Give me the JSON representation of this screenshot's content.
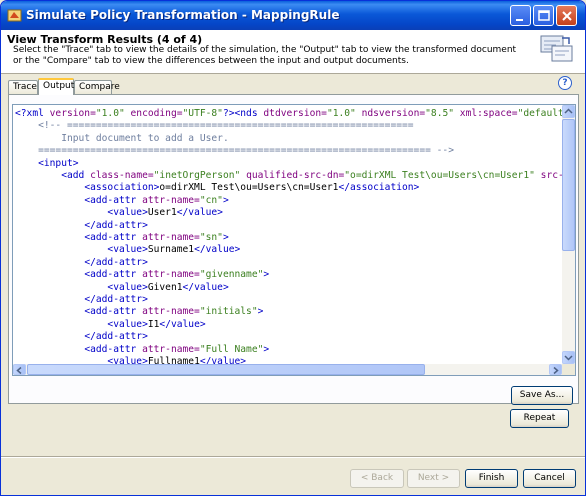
{
  "window": {
    "title": "Simulate Policy Transformation - MappingRule"
  },
  "header": {
    "title": "View Transform Results (4 of 4)",
    "description": "Select the \"Trace\" tab to view the details of the simulation, the \"Output\" tab to view the transformed document or the \"Compare\" tab to view the differences between the input and output documents."
  },
  "tabs": [
    {
      "label": "Trace",
      "active": false
    },
    {
      "label": "Output",
      "active": true
    },
    {
      "label": "Compare",
      "active": false
    }
  ],
  "help": {
    "glyph": "?"
  },
  "code_lines": [
    {
      "indent": "",
      "parts": [
        {
          "t": "<?xml ",
          "c": "tg"
        },
        {
          "t": "version=",
          "c": "an"
        },
        {
          "t": "\"1.0\" ",
          "c": "av"
        },
        {
          "t": "encoding=",
          "c": "an"
        },
        {
          "t": "\"UTF-8\"",
          "c": "av"
        },
        {
          "t": "?><nds ",
          "c": "tg"
        },
        {
          "t": "dtdversion=",
          "c": "an"
        },
        {
          "t": "\"1.0\" ",
          "c": "av"
        },
        {
          "t": "ndsversion=",
          "c": "an"
        },
        {
          "t": "\"8.5\" ",
          "c": "av"
        },
        {
          "t": "xml:space=",
          "c": "an"
        },
        {
          "t": "\"default",
          "c": "av"
        }
      ]
    },
    {
      "indent": "    ",
      "parts": [
        {
          "t": "<!-- ============================================================",
          "c": "cm"
        }
      ]
    },
    {
      "indent": "        ",
      "parts": [
        {
          "t": "Input document to add a User.",
          "c": "cm"
        }
      ]
    },
    {
      "indent": "    ",
      "parts": [
        {
          "t": "==================================================================== -->",
          "c": "cm"
        }
      ]
    },
    {
      "indent": "    ",
      "parts": [
        {
          "t": "<input>",
          "c": "tg"
        }
      ]
    },
    {
      "indent": "        ",
      "parts": [
        {
          "t": "<add ",
          "c": "tg"
        },
        {
          "t": "class-name=",
          "c": "an"
        },
        {
          "t": "\"inetOrgPerson\" ",
          "c": "av"
        },
        {
          "t": "qualified-src-dn=",
          "c": "an"
        },
        {
          "t": "\"o=dirXML Test\\ou=Users\\cn=User1\" ",
          "c": "av"
        },
        {
          "t": "src-",
          "c": "an"
        }
      ]
    },
    {
      "indent": "            ",
      "parts": [
        {
          "t": "<association>",
          "c": "tg"
        },
        {
          "t": "o=dirXML Test\\ou=Users\\cn=User1",
          "c": "tx"
        },
        {
          "t": "</association>",
          "c": "tg"
        }
      ]
    },
    {
      "indent": "            ",
      "parts": [
        {
          "t": "<add-attr ",
          "c": "tg"
        },
        {
          "t": "attr-name=",
          "c": "an"
        },
        {
          "t": "\"cn\"",
          "c": "av"
        },
        {
          "t": ">",
          "c": "tg"
        }
      ]
    },
    {
      "indent": "                ",
      "parts": [
        {
          "t": "<value>",
          "c": "tg"
        },
        {
          "t": "User1",
          "c": "tx"
        },
        {
          "t": "</value>",
          "c": "tg"
        }
      ]
    },
    {
      "indent": "            ",
      "parts": [
        {
          "t": "</add-attr>",
          "c": "tg"
        }
      ]
    },
    {
      "indent": "            ",
      "parts": [
        {
          "t": "<add-attr ",
          "c": "tg"
        },
        {
          "t": "attr-name=",
          "c": "an"
        },
        {
          "t": "\"sn\"",
          "c": "av"
        },
        {
          "t": ">",
          "c": "tg"
        }
      ]
    },
    {
      "indent": "                ",
      "parts": [
        {
          "t": "<value>",
          "c": "tg"
        },
        {
          "t": "Surname1",
          "c": "tx"
        },
        {
          "t": "</value>",
          "c": "tg"
        }
      ]
    },
    {
      "indent": "            ",
      "parts": [
        {
          "t": "</add-attr>",
          "c": "tg"
        }
      ]
    },
    {
      "indent": "            ",
      "parts": [
        {
          "t": "<add-attr ",
          "c": "tg"
        },
        {
          "t": "attr-name=",
          "c": "an"
        },
        {
          "t": "\"givenname\"",
          "c": "av"
        },
        {
          "t": ">",
          "c": "tg"
        }
      ]
    },
    {
      "indent": "                ",
      "parts": [
        {
          "t": "<value>",
          "c": "tg"
        },
        {
          "t": "Given1",
          "c": "tx"
        },
        {
          "t": "</value>",
          "c": "tg"
        }
      ]
    },
    {
      "indent": "            ",
      "parts": [
        {
          "t": "</add-attr>",
          "c": "tg"
        }
      ]
    },
    {
      "indent": "            ",
      "parts": [
        {
          "t": "<add-attr ",
          "c": "tg"
        },
        {
          "t": "attr-name=",
          "c": "an"
        },
        {
          "t": "\"initials\"",
          "c": "av"
        },
        {
          "t": ">",
          "c": "tg"
        }
      ]
    },
    {
      "indent": "                ",
      "parts": [
        {
          "t": "<value>",
          "c": "tg"
        },
        {
          "t": "I1",
          "c": "tx"
        },
        {
          "t": "</value>",
          "c": "tg"
        }
      ]
    },
    {
      "indent": "            ",
      "parts": [
        {
          "t": "</add-attr>",
          "c": "tg"
        }
      ]
    },
    {
      "indent": "            ",
      "parts": [
        {
          "t": "<add-attr ",
          "c": "tg"
        },
        {
          "t": "attr-name=",
          "c": "an"
        },
        {
          "t": "\"Full Name\"",
          "c": "av"
        },
        {
          "t": ">",
          "c": "tg"
        }
      ]
    },
    {
      "indent": "                ",
      "parts": [
        {
          "t": "<value>",
          "c": "tg"
        },
        {
          "t": "Fullname1",
          "c": "tx"
        },
        {
          "t": "</value>",
          "c": "tg"
        }
      ]
    }
  ],
  "buttons": {
    "save_as": "Save As...",
    "repeat": "Repeat",
    "back": "< Back",
    "next": "Next >",
    "finish": "Finish",
    "cancel": "Cancel"
  },
  "colors": {
    "tag": "#0000c8",
    "attr_name": "#7f007f",
    "attr_value": "#3c8020",
    "comment": "#6f7f9f",
    "titlebar": "#0a58d8"
  }
}
